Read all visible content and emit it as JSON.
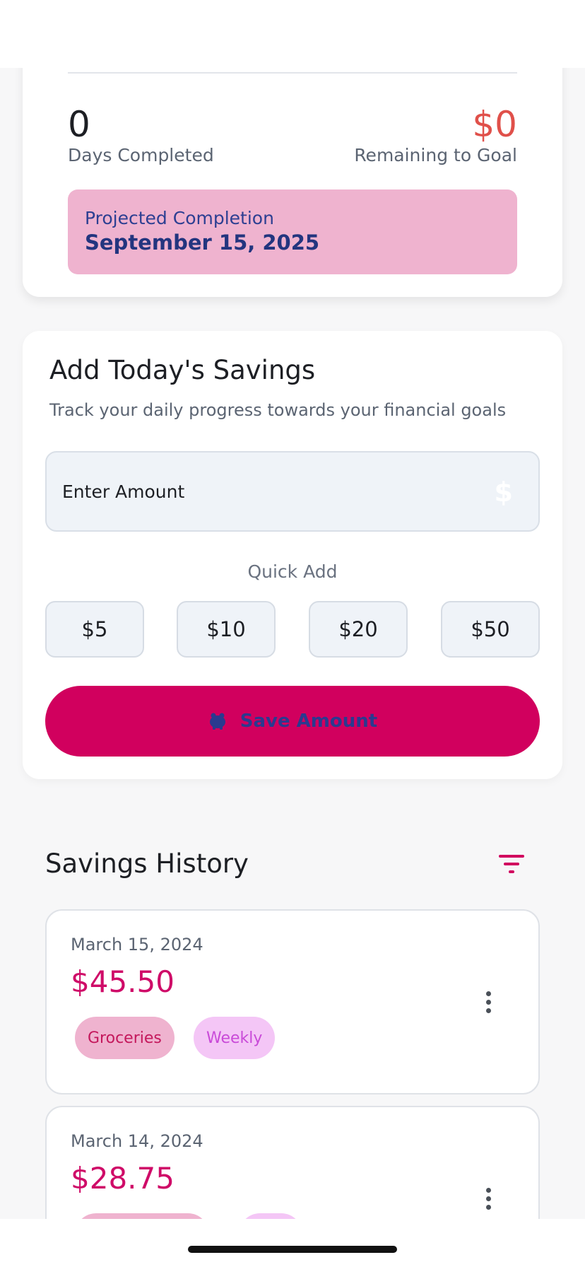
{
  "progress": {
    "days_completed_value": "0",
    "days_completed_label": "Days Completed",
    "remaining_value": "$0",
    "remaining_label": "Remaining to Goal",
    "projected_label": "Projected Completion",
    "projected_date": "September 15, 2025"
  },
  "add_savings": {
    "title": "Add Today's Savings",
    "subtitle": "Track your daily progress towards your financial goals",
    "amount_placeholder": "Enter Amount",
    "quick_add_label": "Quick Add",
    "quick_add_options": [
      "$5",
      "$10",
      "$20",
      "$50"
    ],
    "save_label": "Save Amount"
  },
  "history": {
    "title": "Savings History",
    "entries": [
      {
        "date": "March 15, 2024",
        "amount": "$45.50",
        "category": "Groceries",
        "frequency": "Weekly"
      },
      {
        "date": "March 14, 2024",
        "amount": "$28.75"
      }
    ]
  },
  "colors": {
    "accent": "#d1005e",
    "remaining": "#e0504a",
    "projected_bg": "#efb3cf",
    "projected_text": "#23357f"
  },
  "icons": [
    "dollar-icon",
    "piggy-bank-icon",
    "filter-icon",
    "more-vertical-icon"
  ]
}
